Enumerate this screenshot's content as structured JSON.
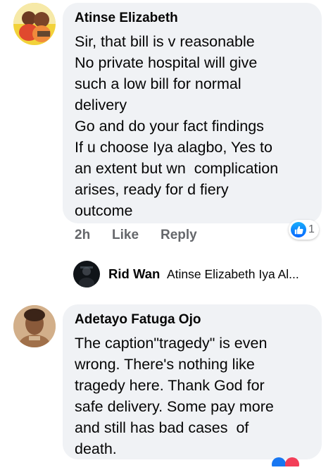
{
  "comments": [
    {
      "author": "Atinse Elizabeth",
      "lines": [
        "Sir, that bill is v reasonable",
        "No private hospital will give",
        "such a low bill for normal",
        "delivery",
        "Go and do your fact findings",
        "If u choose Iya alagbo, Yes to",
        "an extent but wn  complication",
        "arises, ready for d fiery",
        "outcome"
      ],
      "time": "2h",
      "like_label": "Like",
      "reply_label": "Reply",
      "reaction_count": "1"
    },
    {
      "author": "Adetayo Fatuga Ojo",
      "lines": [
        "The caption\"tragedy\" is even",
        "wrong. There's nothing like",
        "tragedy here. Thank God for",
        "safe delivery. Some pay more",
        "and still has bad cases  of",
        "death."
      ]
    }
  ],
  "reply_preview": {
    "author": "Rid Wan",
    "text": "Atinse Elizabeth Iya Al..."
  },
  "colors": {
    "bubble": "#f0f2f5",
    "like_blue": "#1877f2",
    "meta_gray": "#65676b"
  }
}
